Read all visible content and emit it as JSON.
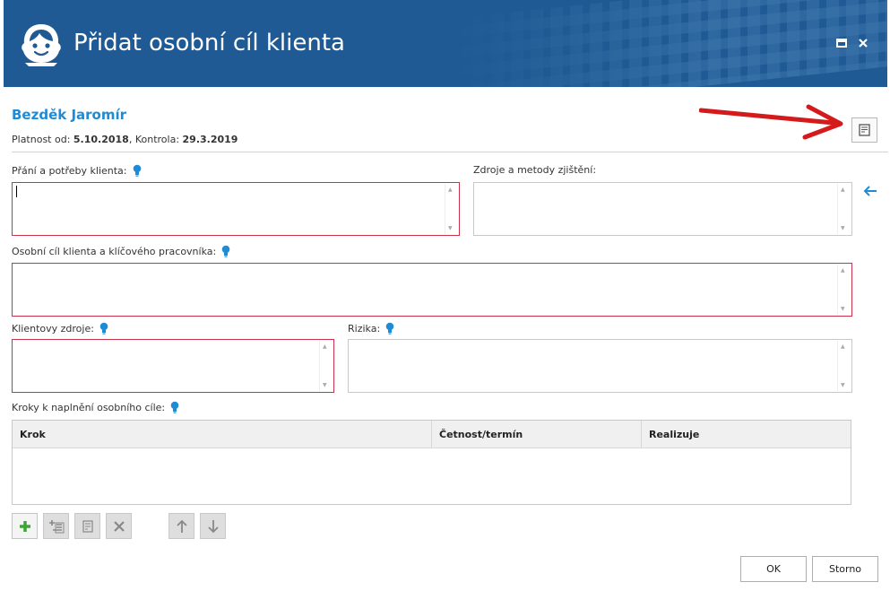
{
  "window": {
    "title": "Přidat osobní cíl klienta",
    "accent": "#1f5a94",
    "logo_icon": "client-face-icon",
    "maximize_icon": "maximize-icon",
    "close_icon": "close-icon"
  },
  "client": {
    "name": "Bezděk Jaromír",
    "validity_prefix": "Platnost od: ",
    "validity_from": "5.10.2018",
    "validity_sep": ", Kontrola: ",
    "validity_check": "29.3.2019",
    "name_color": "#1e8bd4"
  },
  "notes_button": {
    "icon": "notes-icon"
  },
  "fields": {
    "wishes": {
      "label": "Přání a potřeby klienta:",
      "value": "",
      "required": true
    },
    "sources": {
      "label": "Zdroje a metody zjištění:",
      "value": "",
      "required": false
    },
    "goal": {
      "label": "Osobní cíl klienta a klíčového pracovníka:",
      "value": "",
      "required": true
    },
    "client_resources": {
      "label": "Klientovy zdroje:",
      "value": "",
      "required": true
    },
    "risks": {
      "label": "Rizika:",
      "value": "",
      "required": false
    },
    "steps": {
      "label": "Kroky k naplnění osobního cíle:"
    }
  },
  "steps_table": {
    "columns": [
      "Krok",
      "Četnost/termín",
      "Realizuje"
    ],
    "rows": []
  },
  "toolbar": {
    "buttons": [
      {
        "icon": "add-icon",
        "enabled": true
      },
      {
        "icon": "add-substep-icon",
        "enabled": false
      },
      {
        "icon": "edit-icon",
        "enabled": false
      },
      {
        "icon": "delete-icon",
        "enabled": false
      },
      {
        "icon": "move-up-icon",
        "enabled": false
      },
      {
        "icon": "move-down-icon",
        "enabled": false
      }
    ]
  },
  "footer": {
    "ok_label": "OK",
    "cancel_label": "Storno"
  }
}
